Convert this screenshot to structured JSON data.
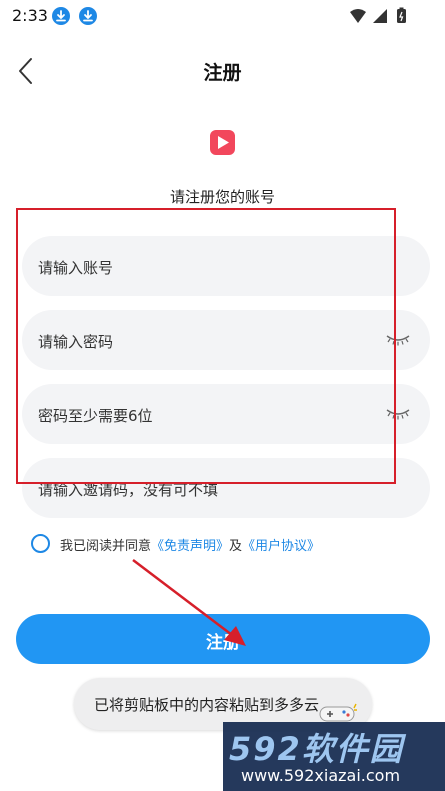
{
  "status_bar": {
    "time": "2:33",
    "icons": [
      "download-icon",
      "download-icon",
      "wifi-icon",
      "signal-icon",
      "battery-icon"
    ]
  },
  "header": {
    "title": "注册",
    "back_icon": "chevron-left-icon"
  },
  "logo": {
    "icon": "play-icon",
    "color": "#F2475C"
  },
  "subtitle": "请注册您的账号",
  "form": {
    "account_placeholder": "请输入账号",
    "password_placeholder": "请输入密码",
    "confirm_placeholder": "密码至少需要6位",
    "invite_placeholder": "请输入邀请码，没有可不填",
    "eye_icon": "eye-closed-icon"
  },
  "agreement": {
    "prefix": "我已阅读并同意",
    "disclaimer_link": "《免责声明》",
    "joiner": "及",
    "user_agreement_link": "《用户协议》"
  },
  "register_button": {
    "label": "注册"
  },
  "toast": {
    "text": "已将剪贴板中的内容粘贴到多多云"
  },
  "watermark": {
    "brand": "592软件园",
    "url": "www.592xiazai.com"
  },
  "colors": {
    "accent": "#2196F3",
    "annotation": "#D61F2A",
    "field_bg": "#F3F4F6"
  }
}
